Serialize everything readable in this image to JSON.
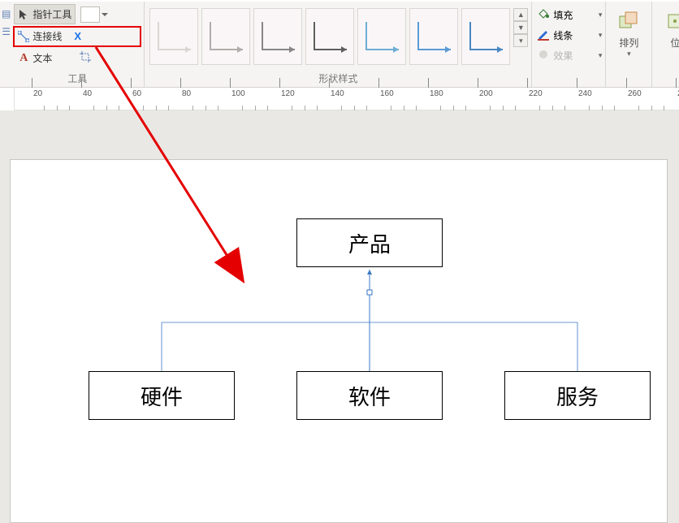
{
  "ribbon": {
    "tools": {
      "pointer_label": "指针工具",
      "connector_label": "连接线",
      "text_label": "文本",
      "group_label": "工具"
    },
    "styles": {
      "group_label": "形状样式"
    },
    "format": {
      "fill_label": "填充",
      "line_label": "线条",
      "effect_label": "效果"
    },
    "arrange": {
      "arrange_label": "排列",
      "position_label": "位"
    }
  },
  "ruler": {
    "start": 10,
    "step": 20,
    "count": 14
  },
  "diagram": {
    "root": "产品",
    "children": [
      "硬件",
      "软件",
      "服务"
    ]
  }
}
